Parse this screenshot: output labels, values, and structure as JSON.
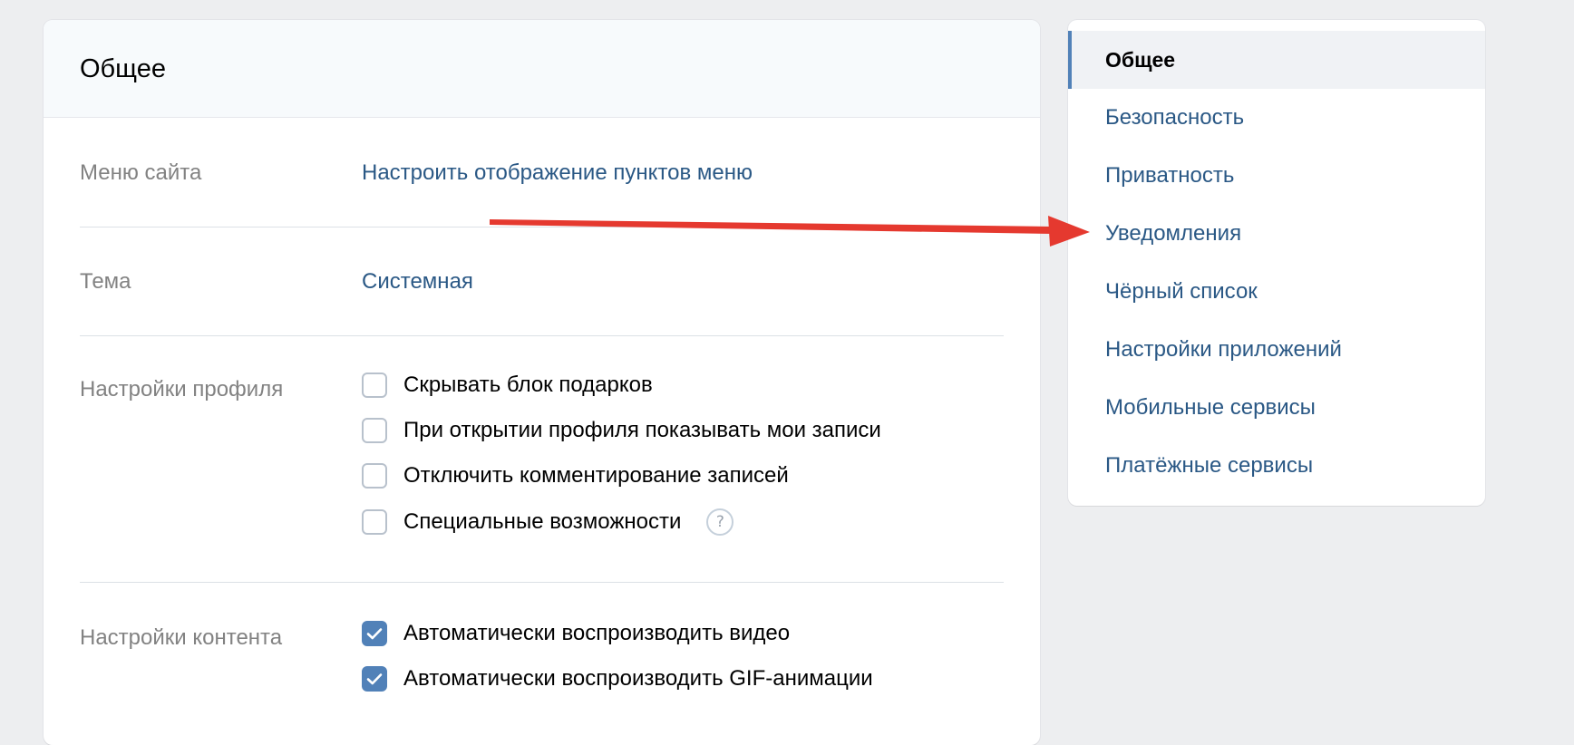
{
  "main": {
    "title": "Общее",
    "rows": {
      "menu": {
        "label": "Меню сайта",
        "value": "Настроить отображение пунктов меню"
      },
      "theme": {
        "label": "Тема",
        "value": "Системная"
      },
      "profile": {
        "label": "Настройки профиля",
        "options": [
          {
            "label": "Скрывать блок подарков",
            "checked": false
          },
          {
            "label": "При открытии профиля показывать мои записи",
            "checked": false
          },
          {
            "label": "Отключить комментирование записей",
            "checked": false
          },
          {
            "label": "Специальные возможности",
            "checked": false
          }
        ],
        "help_icon": "?"
      },
      "content": {
        "label": "Настройки контента",
        "options": [
          {
            "label": "Автоматически воспроизводить видео",
            "checked": true
          },
          {
            "label": "Автоматически воспроизводить GIF-анимации",
            "checked": true
          }
        ]
      }
    }
  },
  "sidebar": {
    "items": [
      {
        "label": "Общее",
        "active": true
      },
      {
        "label": "Безопасность",
        "active": false
      },
      {
        "label": "Приватность",
        "active": false
      },
      {
        "label": "Уведомления",
        "active": false
      },
      {
        "label": "Чёрный список",
        "active": false
      },
      {
        "label": "Настройки приложений",
        "active": false
      },
      {
        "label": "Мобильные сервисы",
        "active": false
      },
      {
        "label": "Платёжные сервисы",
        "active": false
      }
    ]
  },
  "annotation": {
    "target": "Уведомления",
    "color": "#e5392f"
  },
  "colors": {
    "background": "#edeef0",
    "link": "#2a5885",
    "accent": "#5181b8",
    "muted_label": "#828282"
  }
}
